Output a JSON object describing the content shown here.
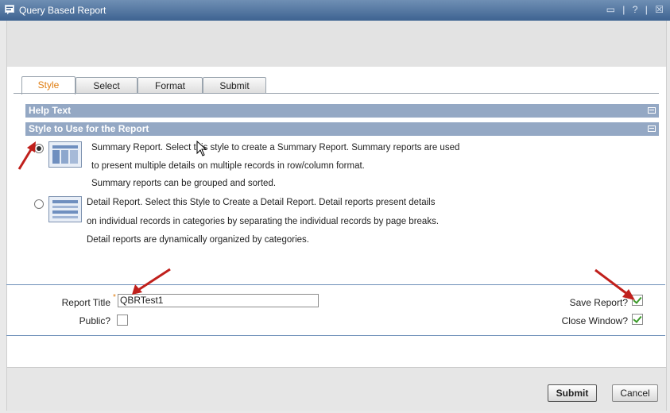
{
  "window": {
    "title": "Query Based Report",
    "controls": [
      "▭",
      "|",
      "?",
      "|",
      "☒"
    ]
  },
  "tabs": [
    {
      "label": "Style",
      "active": true
    },
    {
      "label": "Select",
      "active": false
    },
    {
      "label": "Format",
      "active": false
    },
    {
      "label": "Submit",
      "active": false
    }
  ],
  "sections": {
    "help_text": "Help Text",
    "style_header": "Style to Use for the Report"
  },
  "options": {
    "summary": {
      "selected": true,
      "lines": [
        "Summary Report. Select this style to create a Summary Report. Summary reports are used",
        "to present multiple details on multiple records in row/column format.",
        "Summary reports can be grouped and sorted."
      ]
    },
    "detail": {
      "selected": false,
      "lines": [
        "Detail Report. Select this Style to Create a Detail Report. Detail reports present details",
        "on individual records in categories by separating the individual records by page breaks.",
        "Detail reports are dynamically organized by categories."
      ]
    }
  },
  "form": {
    "report_title_label": "Report Title",
    "required_mark": "*",
    "report_title_value": "QBRTest1",
    "public_label": "Public?",
    "public_checked": false,
    "save_report_label": "Save Report?",
    "save_report_checked": true,
    "close_window_label": "Close Window?",
    "close_window_checked": true
  },
  "buttons": {
    "submit": "Submit",
    "cancel": "Cancel"
  },
  "colors": {
    "accent": "#e07d10",
    "titlebar": "#3e6391",
    "section_bar": "#94a8c4",
    "annotation_arrow": "#c0201c"
  }
}
